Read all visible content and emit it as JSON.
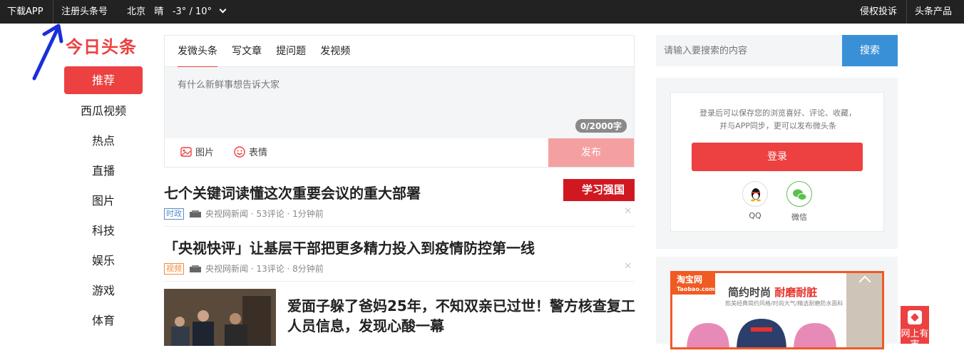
{
  "topbar": {
    "download": "下载APP",
    "register": "注册头条号",
    "city": "北京",
    "weather": "晴",
    "temp": "-3° / 10°",
    "report": "侵权投诉",
    "products": "头条产品"
  },
  "logo": "今日头条",
  "nav": [
    "推荐",
    "西瓜视频",
    "热点",
    "直播",
    "图片",
    "科技",
    "娱乐",
    "游戏",
    "体育"
  ],
  "composer": {
    "tabs": [
      "发微头条",
      "写文章",
      "提问题",
      "发视频"
    ],
    "placeholder": "有什么新鲜事想告诉大家",
    "counter": "0/2000字",
    "tools": [
      "图片",
      "表情"
    ],
    "publish": "发布"
  },
  "feed": [
    {
      "title": "七个关键词读懂这次重要会议的重大部署",
      "tag": "时政",
      "meta": "央视网新闻 · 53评论 · 1分钟前",
      "badge": "学习强国"
    },
    {
      "title": "「央视快评」让基层干部把更多精力投入到疫情防控第一线",
      "tag": "视频",
      "meta": "央视网新闻 · 13评论 · 8分钟前"
    },
    {
      "title_line1": "爱面子躲了爸妈25年，不知双亲已过世！警方核查复工",
      "title_line2": "人员信息，发现心酸一幕"
    }
  ],
  "search": {
    "placeholder": "请输入要搜索的内容",
    "button": "搜索"
  },
  "login": {
    "tip_line1": "登录后可以保存您的浏览喜好、评论、收藏，",
    "tip_line2": "并与APP同步，更可以发布微头条",
    "button": "登录",
    "qq": "QQ",
    "wechat": "微信"
  },
  "ad": {
    "logo_line1": "淘宝网",
    "logo_line2": "Taobao.com",
    "headline": "简约时尚",
    "headline_red": "耐磨耐脏",
    "sub": "款美经典简约风格/时尚大气/精选耐磨防水面料"
  },
  "float": "网上有害",
  "colors": {
    "brand_red": "#ed4040",
    "search_blue": "#3a90d7",
    "topbar": "#222222"
  }
}
